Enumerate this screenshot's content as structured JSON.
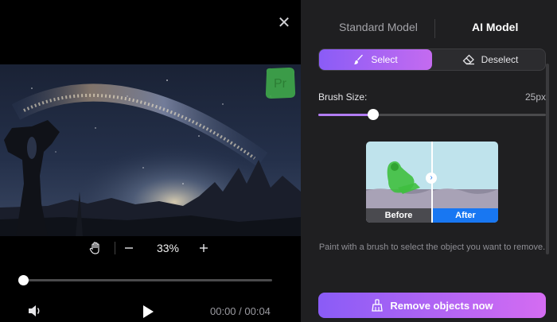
{
  "preview": {
    "close_icon": "close-icon",
    "zoom": {
      "value": "33%",
      "hand_icon": "hand-icon",
      "minus_icon": "minus-icon",
      "plus_icon": "plus-icon"
    },
    "progress": 0.0,
    "time_text": "00:00 / 00:04",
    "logo_text": "Pr"
  },
  "tabs": [
    {
      "label": "Standard Model",
      "active": false
    },
    {
      "label": "AI Model",
      "active": true
    }
  ],
  "mode": {
    "select_label": "Select",
    "deselect_label": "Deselect",
    "active": "select"
  },
  "brush": {
    "label": "Brush Size:",
    "value_text": "25px",
    "level": 0.24
  },
  "demo": {
    "before_label": "Before",
    "after_label": "After"
  },
  "hint_text": "Paint with a brush to select the object you want to remove.",
  "cta": {
    "label": "Remove objects now"
  },
  "colors": {
    "accent_start": "#8a5cf6",
    "accent_end": "#d46cf2",
    "after_badge": "#1877f2",
    "panel_bg": "#1f1f21"
  }
}
